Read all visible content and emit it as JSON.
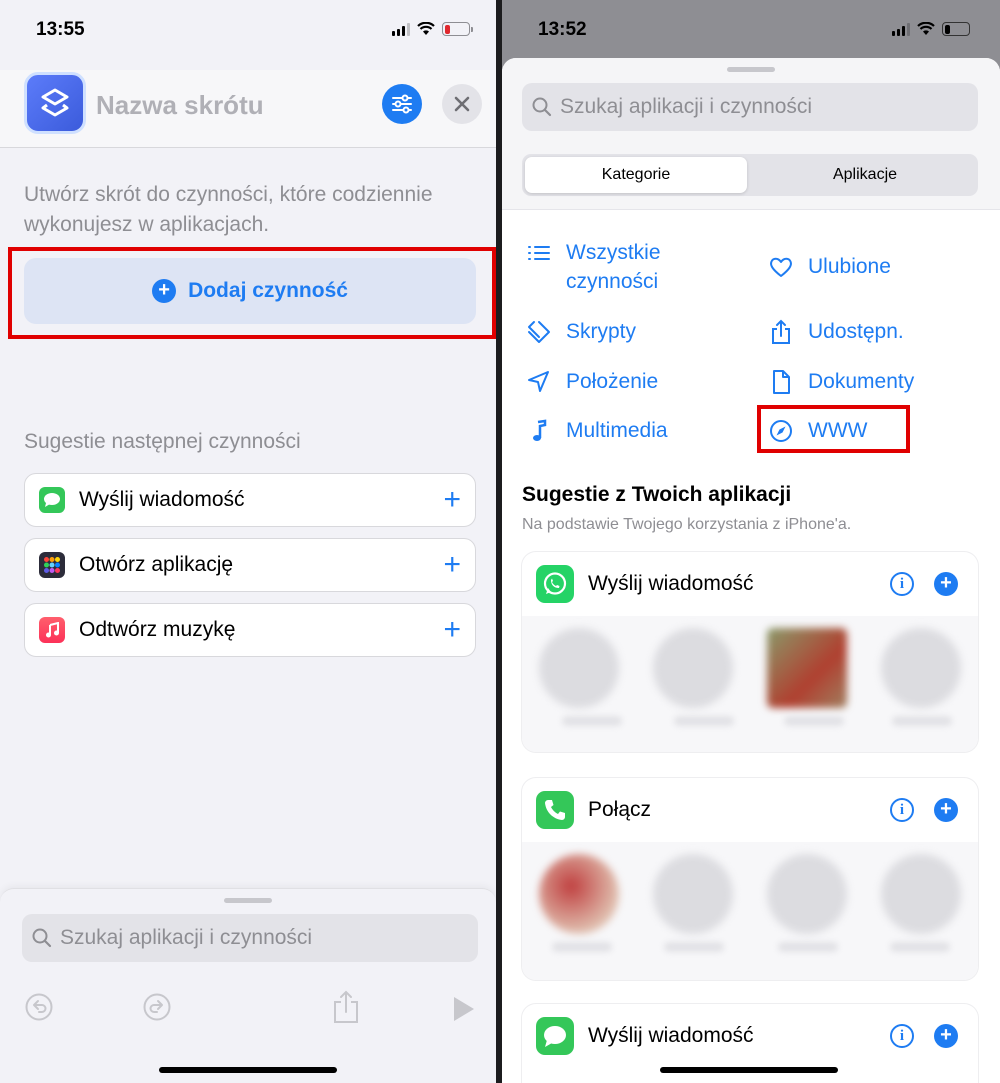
{
  "left": {
    "status": {
      "time": "13:55"
    },
    "header": {
      "title": "Nazwa skrótu"
    },
    "description": "Utwórz skrót do czynności, które codziennie wykonujesz w aplikacjach.",
    "add_action_label": "Dodaj czynność",
    "suggestions_title": "Sugestie następnej czynności",
    "suggestions": [
      {
        "label": "Wyślij wiadomość",
        "icon": "messages-icon"
      },
      {
        "label": "Otwórz aplikację",
        "icon": "apps-grid-icon"
      },
      {
        "label": "Odtwórz muzykę",
        "icon": "music-icon"
      }
    ],
    "search": {
      "placeholder": "Szukaj aplikacji i czynności"
    }
  },
  "right": {
    "status": {
      "time": "13:52"
    },
    "search": {
      "placeholder": "Szukaj aplikacji i czynności"
    },
    "segments": {
      "active": "Kategorie",
      "inactive": "Aplikacje"
    },
    "categories": [
      {
        "label_line1": "Wszystkie",
        "label_line2": "czynności",
        "icon": "list-icon"
      },
      {
        "label": "Ulubione",
        "icon": "heart-icon"
      },
      {
        "label": "Skrypty",
        "icon": "scripts-icon"
      },
      {
        "label": "Udostępn.",
        "icon": "share-icon"
      },
      {
        "label": "Położenie",
        "icon": "location-icon"
      },
      {
        "label": "Dokumenty",
        "icon": "document-icon"
      },
      {
        "label": "Multimedia",
        "icon": "music-note-icon"
      },
      {
        "label": "WWW",
        "icon": "compass-icon"
      }
    ],
    "apps_section": {
      "title": "Sugestie z Twoich aplikacji",
      "subtitle": "Na podstawie Twojego korzystania z iPhone'a."
    },
    "cards": [
      {
        "title": "Wyślij wiadomość",
        "app": "whatsapp-icon"
      },
      {
        "title": "Połącz",
        "app": "phone-icon"
      },
      {
        "title": "Wyślij wiadomość",
        "app": "messages-icon"
      }
    ]
  },
  "colors": {
    "accent": "#1e7cf2",
    "highlight": "#e00000",
    "background": "#f2f2f7"
  }
}
